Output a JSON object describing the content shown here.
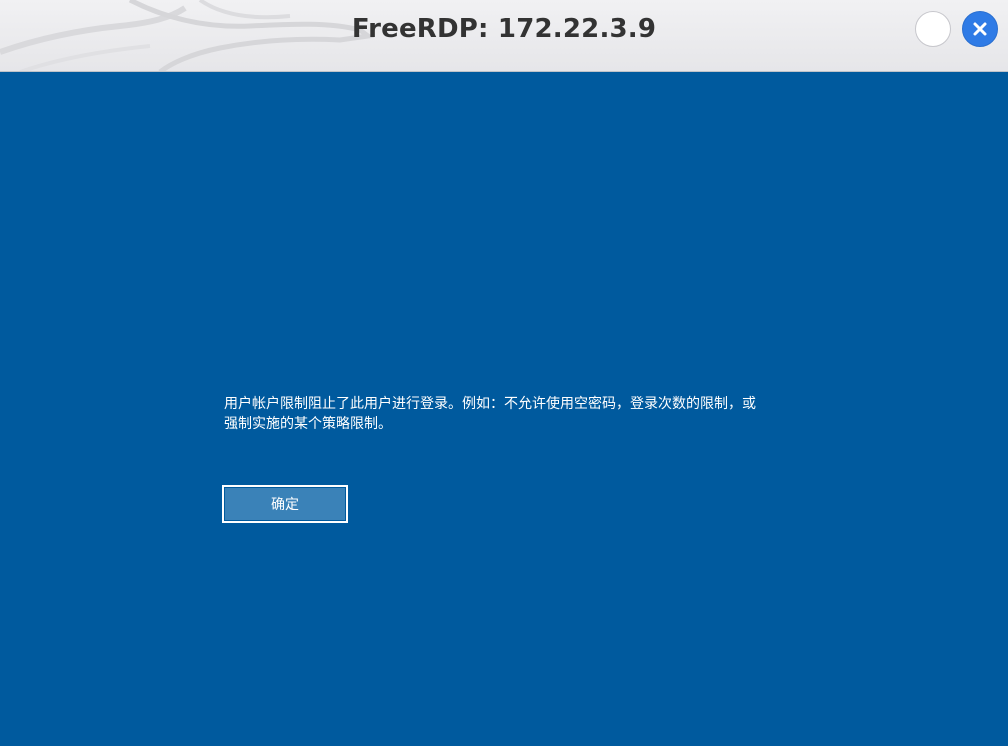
{
  "window": {
    "title": "FreeRDP: 172.22.3.9"
  },
  "icons": {
    "minimize": "circle-button-icon",
    "close": "close-icon",
    "title_art": "dragon-watermark-icon"
  },
  "dialog": {
    "message_line1": "用户帐户限制阻止了此用户进行登录。例如：不允许使用空密码，登录次数的限制，或",
    "message_line2": "强制实施的某个策略限制。",
    "ok_label": "确定"
  },
  "colors": {
    "background": "#005a9e",
    "titlebar": "#ececee",
    "close_button": "#2f7be6",
    "button_fill": "#3a82b8"
  }
}
